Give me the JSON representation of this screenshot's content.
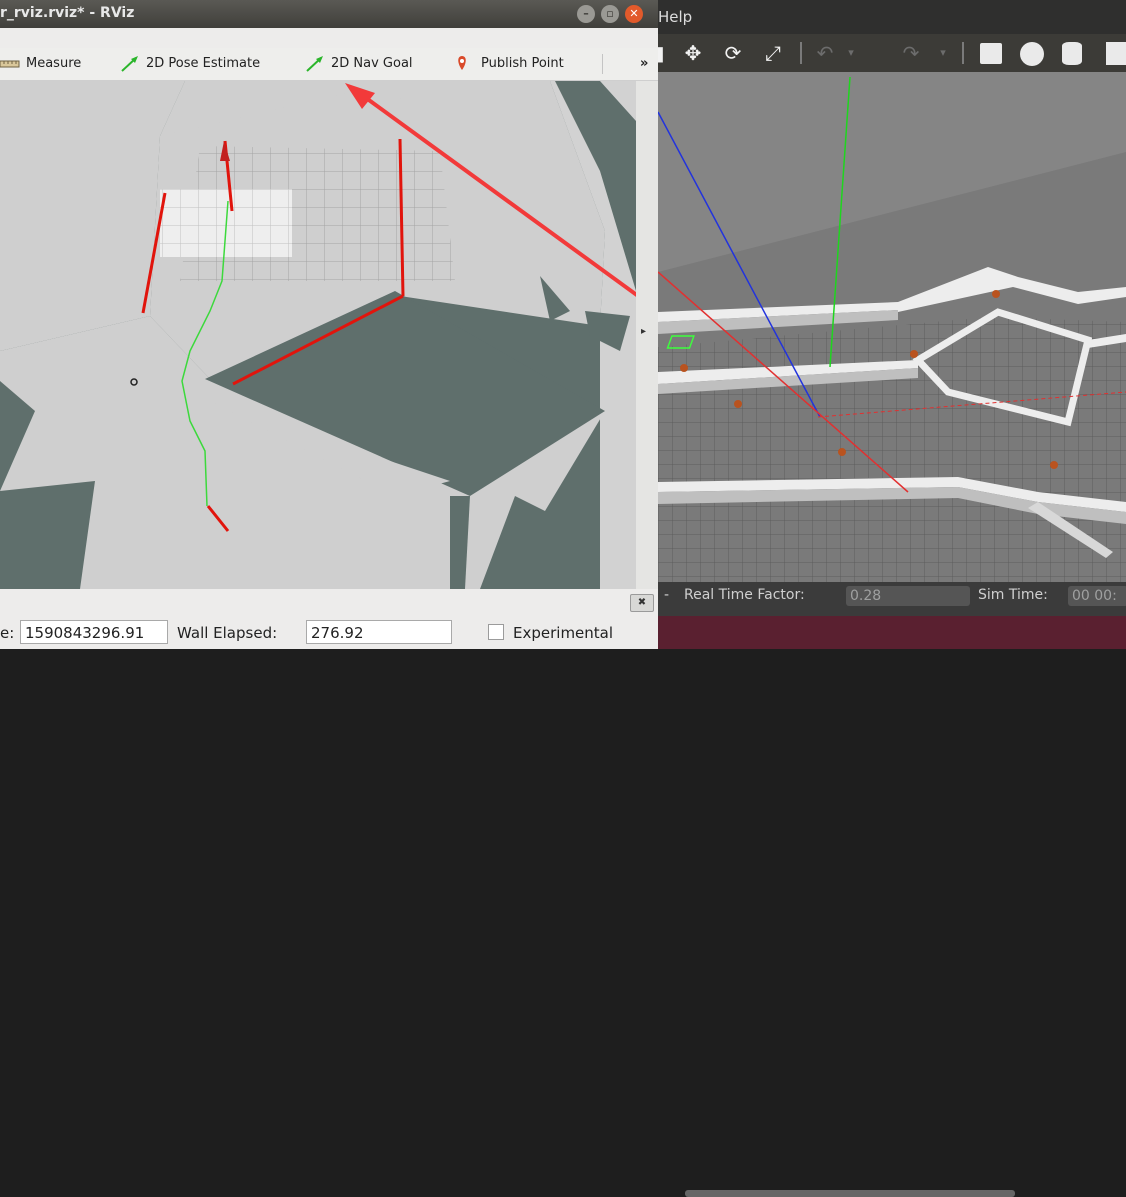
{
  "rviz": {
    "title": "r_rviz.rviz* - RViz",
    "toolbar": {
      "measure": "Measure",
      "pose_estimate": "2D Pose Estimate",
      "nav_goal": "2D Nav Goal",
      "publish_point": "Publish Point",
      "more": "»"
    },
    "side_arrow": "▸",
    "close_panel": "✖",
    "time": {
      "ros_time_label": "e:",
      "ros_time_value": "1590843296.91",
      "wall_elapsed_label": "Wall Elapsed:",
      "wall_elapsed_value": "276.92",
      "experimental_label": "Experimental"
    }
  },
  "gazebo": {
    "menu_help": "Help",
    "status": {
      "rtf_label": "Real Time Factor:",
      "rtf_value": "0.28",
      "sim_time_label": "Sim Time:",
      "sim_time_value": "00 00:"
    }
  },
  "icons": [
    "select-icon",
    "translate-icon",
    "rotate-icon",
    "scale-icon",
    "undo-icon",
    "redo-icon",
    "box-icon",
    "sphere-icon",
    "cylinder-icon",
    "measure-icon",
    "pose-arrow-icon",
    "nav-goal-arrow-icon",
    "publish-point-icon"
  ],
  "colors": {
    "map_free": "#cfcfcf",
    "map_unknown": "#5f6f6c",
    "laser": "#e1140c",
    "path": "#3cd93c",
    "annotation_arrow": "#f23a3a"
  }
}
